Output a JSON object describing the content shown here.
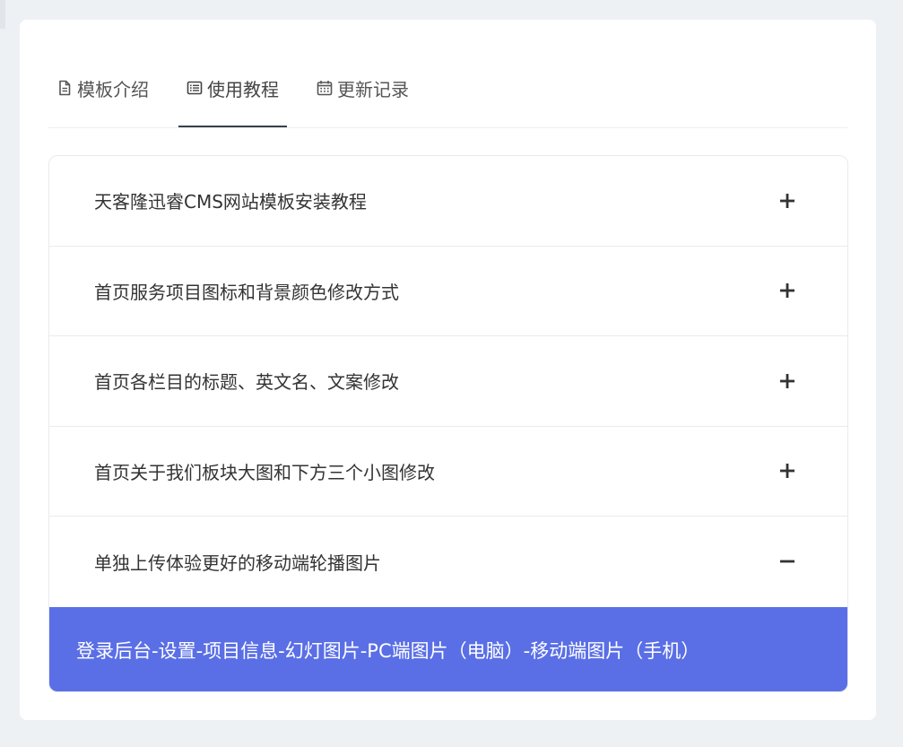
{
  "tabs": [
    {
      "label": "模板介绍",
      "icon": "document-icon",
      "active": false
    },
    {
      "label": "使用教程",
      "icon": "list-icon",
      "active": true
    },
    {
      "label": "更新记录",
      "icon": "calendar-icon",
      "active": false
    }
  ],
  "accordion": {
    "items": [
      {
        "title": "天客隆迅睿CMS网站模板安装教程",
        "toggle": "plus"
      },
      {
        "title": "首页服务项目图标和背景颜色修改方式",
        "toggle": "plus"
      },
      {
        "title": "首页各栏目的标题、英文名、文案修改",
        "toggle": "plus"
      },
      {
        "title": "首页关于我们板块大图和下方三个小图修改",
        "toggle": "plus"
      },
      {
        "title": "单独上传体验更好的移动端轮播图片",
        "toggle": "minus"
      }
    ],
    "expanded_content": "登录后台-设置-项目信息-幻灯图片-PC端图片（电脑）-移动端图片（手机）"
  },
  "colors": {
    "accent": "#5a6fe6",
    "page_bg": "#eef1f4",
    "active_tab_underline": "#3a3f4b"
  }
}
